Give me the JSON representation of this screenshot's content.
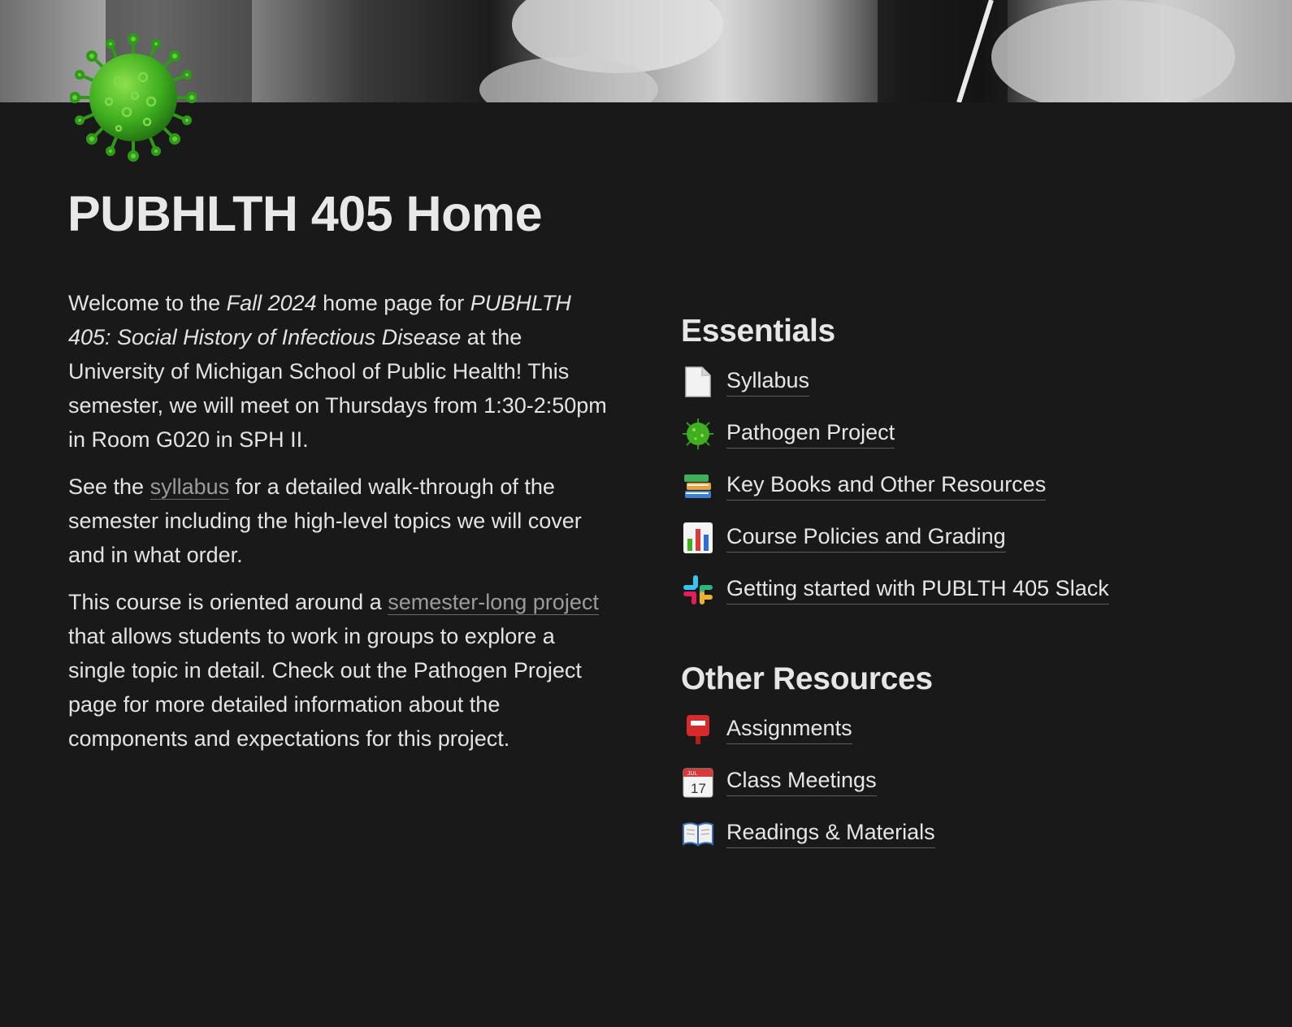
{
  "page": {
    "title": "PUBHLTH 405 Home",
    "cover_image": "black-and-white historical photograph (cover banner)",
    "icon": "virus-icon"
  },
  "intro": {
    "p1_a": "Welcome to the ",
    "p1_b": "Fall 2024",
    "p1_c": " home page for ",
    "p1_d": "PUBHLTH 405: Social History of Infectious Disease",
    "p1_e": " at the University of Michigan School of Public Health!  This semester, we will meet on Thursdays from 1:30-2:50pm in Room G020 in SPH II.",
    "p2_a": "See the ",
    "p2_link": "syllabus",
    "p2_b": " for a detailed walk-through of the semester including the high-level topics we will cover and in what order.",
    "p3_a": "This course is oriented around a ",
    "p3_link": "semester-long project",
    "p3_b": " that allows students to work in groups to explore a single topic in detail. Check out the Pathogen Project page for more detailed information about the components and expectations for this project."
  },
  "essentials": {
    "heading": "Essentials",
    "items": [
      {
        "label": "Syllabus",
        "icon": "page-icon"
      },
      {
        "label": "Pathogen Project",
        "icon": "virus-icon"
      },
      {
        "label": "Key Books and Other Resources",
        "icon": "books-icon"
      },
      {
        "label": "Course Policies and Grading",
        "icon": "bar-chart-icon"
      },
      {
        "label": "Getting started with PUBLTH 405 Slack",
        "icon": "slack-icon"
      }
    ]
  },
  "other_resources": {
    "heading": "Other Resources",
    "items": [
      {
        "label": "Assignments",
        "icon": "mailbox-icon"
      },
      {
        "label": "Class Meetings",
        "icon": "calendar-icon"
      },
      {
        "label": "Readings & Materials",
        "icon": "open-book-icon"
      }
    ]
  },
  "calendar_icon": {
    "month": "JUL",
    "day": "17"
  },
  "colors": {
    "background": "#191919",
    "text": "#e6e6e6",
    "link_muted": "#9b9b9b",
    "virus_green": "#3fae1f"
  }
}
